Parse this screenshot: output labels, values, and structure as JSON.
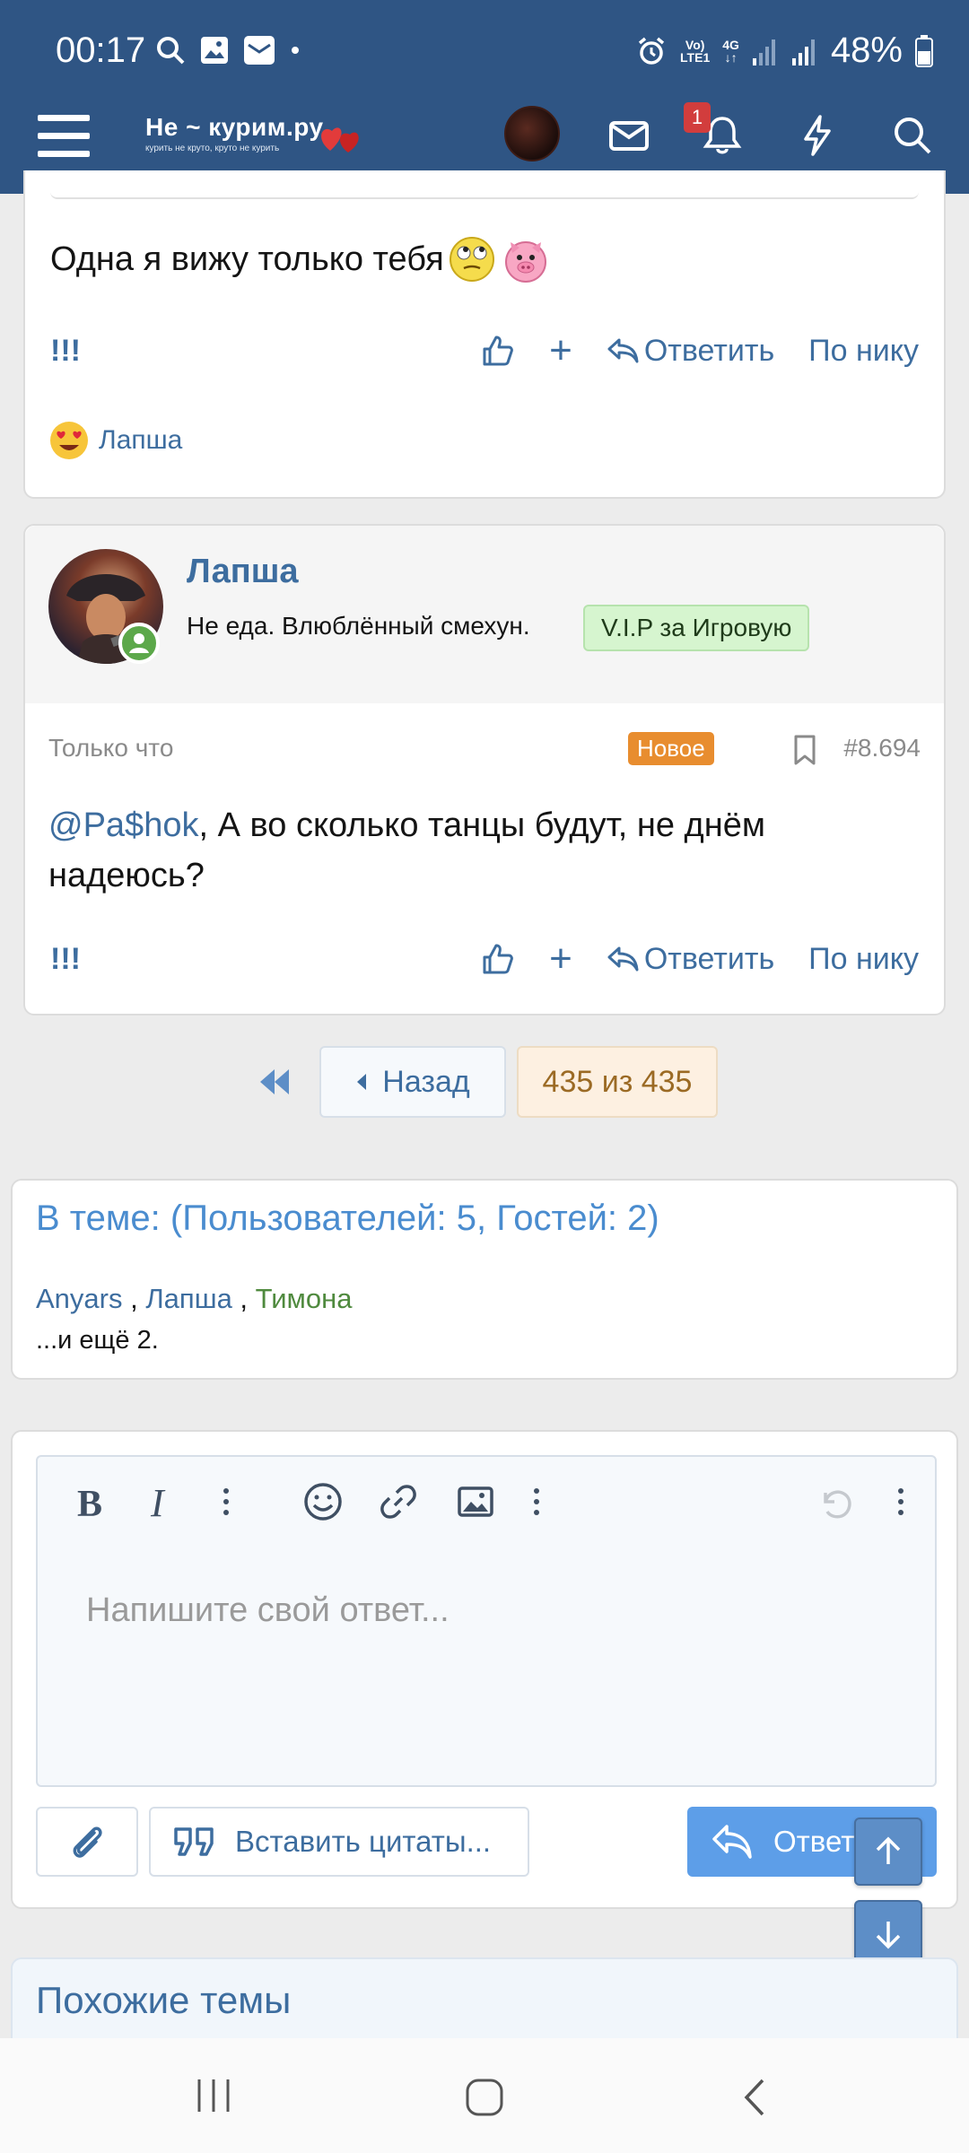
{
  "status_bar": {
    "time": "00:17",
    "lte_top": "Vo)",
    "lte_bottom": "LTE1",
    "net": "4G",
    "battery": "48%"
  },
  "header": {
    "logo_text": "Не ~ курим.ру",
    "logo_tagline": "курить не круто, круто не курить",
    "notifications_count": "1"
  },
  "post1": {
    "text": "Одна я вижу только тебя",
    "actions": {
      "excl": "!!!",
      "plus": "+",
      "reply": "Ответить",
      "by_nick": "По нику"
    },
    "reaction_user": "Лапша"
  },
  "post2": {
    "author": "Лапша",
    "author_title": "Не еда. Влюблённый смехун.",
    "author_badge": "V.I.P за Игровую",
    "time": "Только что",
    "new_label": "Новое",
    "post_number": "#8.694",
    "mention": "@Pa$hok",
    "text": ", А во сколько танцы будут, не днём надеюсь?",
    "actions": {
      "excl": "!!!",
      "plus": "+",
      "reply": "Ответить",
      "by_nick": "По нику"
    }
  },
  "pager": {
    "back": "Назад",
    "current": "435 из 435"
  },
  "in_topic": {
    "title": "В теме: (Пользователей: 5, Гостей: 2)",
    "users": [
      "Anyars",
      "Лапша",
      "Тимона"
    ],
    "sep": " , ",
    "more": "...и ещё 2."
  },
  "editor": {
    "placeholder": "Напишите свой ответ...",
    "insert_quotes": "Вставить цитаты...",
    "reply": "Ответить"
  },
  "similar": {
    "title": "Похожие темы"
  },
  "colors": {
    "header_bg": "#2f5584",
    "link": "#3d6d9f",
    "accent_blue": "#5d9ee8",
    "new_badge": "#e88d2f",
    "vip_badge_bg": "#d6f5cf"
  }
}
